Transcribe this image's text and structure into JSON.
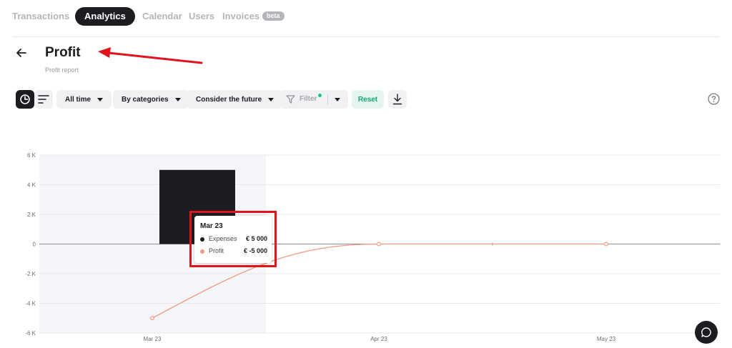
{
  "nav": {
    "tabs": [
      {
        "label": "Transactions"
      },
      {
        "label": "Analytics"
      },
      {
        "label": "Calendar"
      },
      {
        "label": "Users"
      },
      {
        "label": "Invoices"
      }
    ],
    "active_tab": "Analytics",
    "beta_badge": "beta"
  },
  "header": {
    "title": "Profit",
    "subtitle": "Profit report"
  },
  "toolbar": {
    "period": "All time",
    "grouping": "By categories",
    "future": "Consider the future",
    "filter": "Filter",
    "reset": "Reset"
  },
  "colors": {
    "primary": "#1c1d21",
    "profit": "#f39a7f",
    "accent_green": "#14a576",
    "annotation_red": "#e0141b",
    "highlight_band": "#f5f6fa"
  },
  "icons": [
    "back-arrow-icon",
    "pie-chart-icon",
    "sort-lines-icon",
    "filter-funnel-icon",
    "download-icon",
    "help-icon",
    "chat-icon"
  ],
  "chart_data": {
    "type": "bar",
    "x_categories": [
      "Mar 23",
      "Apr 23",
      "May 23"
    ],
    "y_ticks": [
      "6 K",
      "4 K",
      "2 K",
      "0",
      "-2 K",
      "-4 K",
      "-6 K"
    ],
    "ylim": [
      -6000,
      6000
    ],
    "series": [
      {
        "name": "Expenses",
        "kind": "bar",
        "values": [
          5000,
          0,
          0
        ]
      },
      {
        "name": "Profit",
        "kind": "line",
        "values": [
          -5000,
          0,
          0
        ]
      }
    ],
    "highlighted_category": "Mar 23"
  },
  "tooltip": {
    "date": "Mar 23",
    "rows": [
      {
        "name": "Expenses",
        "value": "€ 5 000"
      },
      {
        "name": "Profit",
        "value": "€ -5 000"
      }
    ]
  }
}
